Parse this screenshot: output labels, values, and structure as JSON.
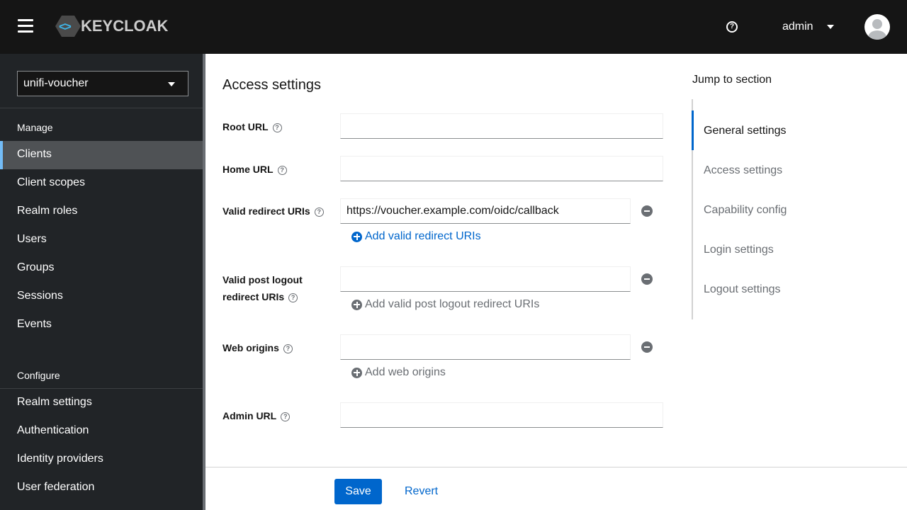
{
  "header": {
    "logo": "KEYCLOAK",
    "user": "admin"
  },
  "sidebar": {
    "realm": "unifi-voucher",
    "manage_label": "Manage",
    "manage_items": [
      "Clients",
      "Client scopes",
      "Realm roles",
      "Users",
      "Groups",
      "Sessions",
      "Events"
    ],
    "configure_label": "Configure",
    "configure_items": [
      "Realm settings",
      "Authentication",
      "Identity providers",
      "User federation"
    ],
    "active": "Clients"
  },
  "form": {
    "title": "Access settings",
    "root_url": {
      "label": "Root URL",
      "value": ""
    },
    "home_url": {
      "label": "Home URL",
      "value": ""
    },
    "redirect": {
      "label": "Valid redirect URIs",
      "value": "https://voucher.example.com/oidc/callback",
      "add": "Add valid redirect URIs"
    },
    "post_logout": {
      "label_line1": "Valid post logout",
      "label_line2": "redirect URIs",
      "value": "",
      "add": "Add valid post logout redirect URIs"
    },
    "web_origins": {
      "label": "Web origins",
      "value": "",
      "add": "Add web origins"
    },
    "admin_url": {
      "label": "Admin URL",
      "value": ""
    },
    "save": "Save",
    "revert": "Revert"
  },
  "jump": {
    "title": "Jump to section",
    "items": [
      "General settings",
      "Access settings",
      "Capability config",
      "Login settings",
      "Logout settings"
    ],
    "active": "General settings"
  },
  "colors": {
    "primary": "#0066cc",
    "header": "#151515",
    "sidebar": "#212427"
  }
}
